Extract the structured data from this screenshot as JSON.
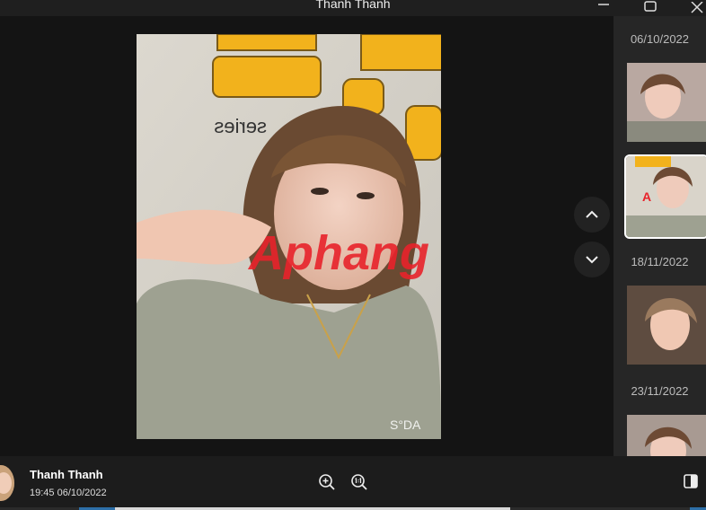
{
  "window": {
    "title": "Thanh Thanh"
  },
  "viewer": {
    "watermark": "Aphang",
    "camera_mark": "S°DA"
  },
  "sidebar": {
    "groups": [
      {
        "date": "06/10/2022",
        "thumbnails": 2,
        "selected_index": 1
      },
      {
        "date": "18/11/2022",
        "thumbnails": 1
      },
      {
        "date": "23/11/2022",
        "thumbnails": 1
      }
    ]
  },
  "footer": {
    "sender_name": "Thanh Thanh",
    "timestamp": "19:45 06/10/2022"
  },
  "icons": {
    "minimize": "minimize-icon",
    "maximize": "maximize-icon",
    "close": "close-icon",
    "prev": "chevron-up-icon",
    "next": "chevron-down-icon",
    "zoom_in": "zoom-in-icon",
    "zoom_fit": "zoom-actual-size-icon",
    "panel": "sidebar-toggle-icon"
  },
  "colors": {
    "background": "#141414",
    "sidebar": "#262626",
    "watermark_red": "#e8232b",
    "watermark_blue": "#1b8fd6"
  }
}
